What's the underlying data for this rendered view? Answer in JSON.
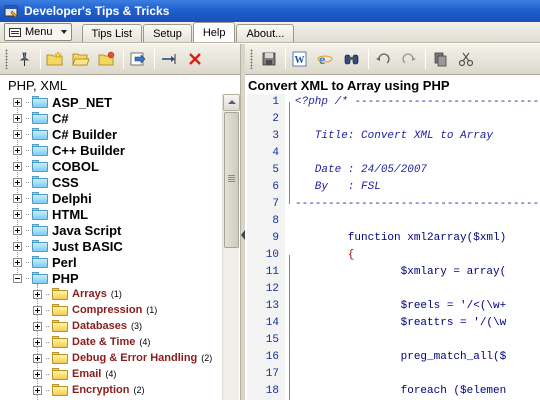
{
  "app": {
    "title": "Developer's Tips & Tricks"
  },
  "menubar": {
    "menu_label": "Menu",
    "tabs": [
      {
        "label": "Tips List",
        "active": false
      },
      {
        "label": "Setup",
        "active": false
      },
      {
        "label": "Help",
        "active": true
      },
      {
        "label": "About...",
        "active": false
      }
    ]
  },
  "left_toolbar": {
    "icons": [
      "pin-icon",
      "new-folder-icon",
      "open-folder-icon",
      "folder-star-icon",
      "import-icon",
      "move-icon",
      "delete-icon"
    ]
  },
  "right_toolbar": {
    "icons": [
      "save-icon",
      "word-icon",
      "browser-icon",
      "find-icon",
      "undo-icon",
      "redo-icon",
      "copy-icon",
      "cut-icon"
    ]
  },
  "left_panel": {
    "header": "PHP, XML",
    "top_items": [
      {
        "label": "ASP_NET",
        "expanded": false
      },
      {
        "label": "C#",
        "expanded": false
      },
      {
        "label": "C# Builder",
        "expanded": false
      },
      {
        "label": "C++ Builder",
        "expanded": false
      },
      {
        "label": "COBOL",
        "expanded": false
      },
      {
        "label": "CSS",
        "expanded": false
      },
      {
        "label": "Delphi",
        "expanded": false
      },
      {
        "label": "HTML",
        "expanded": false
      },
      {
        "label": "Java Script",
        "expanded": false
      },
      {
        "label": "Just BASIC",
        "expanded": false
      },
      {
        "label": "Perl",
        "expanded": false
      },
      {
        "label": "PHP",
        "expanded": true
      }
    ],
    "php_children": [
      {
        "label": "Arrays",
        "count": "(1)"
      },
      {
        "label": "Compression",
        "count": "(1)"
      },
      {
        "label": "Databases",
        "count": "(3)"
      },
      {
        "label": "Date & Time",
        "count": "(4)"
      },
      {
        "label": "Debug & Error Handling",
        "count": "(2)"
      },
      {
        "label": "Email",
        "count": "(4)"
      },
      {
        "label": "Encryption",
        "count": "(2)"
      }
    ]
  },
  "right_panel": {
    "header": "Convert XML to Array using PHP",
    "line_numbers": [
      "1",
      "2",
      "3",
      "4",
      "5",
      "6",
      "7",
      "8",
      "9",
      "10",
      "11",
      "12",
      "13",
      "14",
      "15",
      "16",
      "17",
      "18"
    ],
    "code_lines": [
      "<?php /* -------------------------------",
      "",
      "   Title: Convert XML to Array",
      "",
      "   Date : 24/05/2007",
      "   By   : FSL",
      "-----------------------------------------",
      "",
      "        function xml2array($xml)",
      "        {",
      "                $xmlary = array(",
      "",
      "                $reels = '/<(\\w+",
      "                $reattrs = '/(\\w",
      "",
      "                preg_match_all($",
      "",
      "                foreach ($elemen"
    ]
  }
}
